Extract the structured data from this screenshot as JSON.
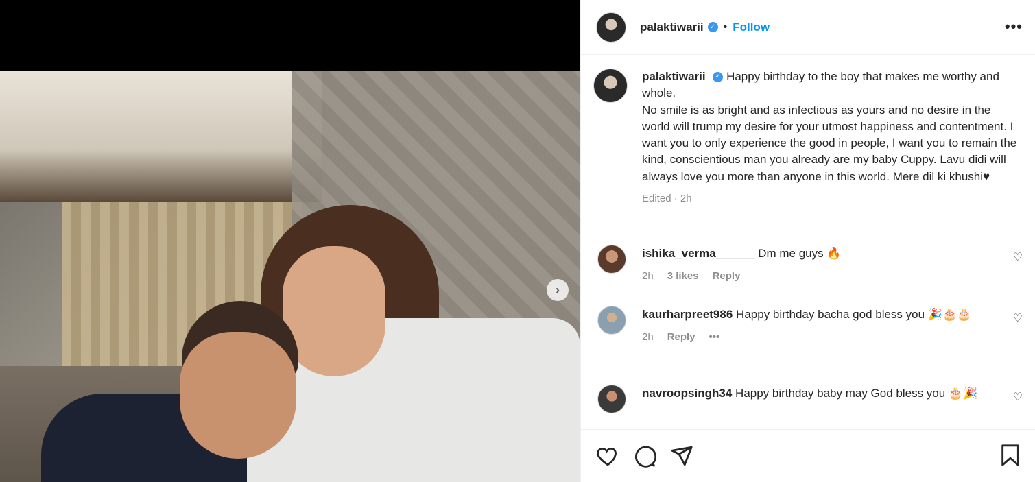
{
  "post": {
    "username": "palaktiwarii",
    "follow_label": "Follow",
    "dot": "•",
    "more": "•••"
  },
  "caption": {
    "username": "palaktiwarii",
    "text_line1": "Happy birthday to the boy that makes me worthy and whole.",
    "text_line2": "No smile is as bright and as infectious as yours and no desire in the world will trump my desire for your utmost happiness and contentment. I want you to only experience the good in people, I want you to remain the kind, conscientious man you already are my baby Cuppy. Lavu didi will always love you more than anyone in this world. Mere dil ki khushi♥",
    "meta": "Edited · 2h"
  },
  "comments": [
    {
      "username": "ishika_verma______",
      "text": "Dm me guys 🔥",
      "time": "2h",
      "likes": "3 likes",
      "reply": "Reply"
    },
    {
      "username": "kaurharpreet986",
      "text": "Happy birthday bacha god bless you 🎉🎂🎂",
      "time": "2h",
      "reply": "Reply",
      "more": "•••"
    },
    {
      "username": "navroopsingh34",
      "text": "Happy birthday baby may God bless you 🎂🎉",
      "time": "",
      "reply": ""
    }
  ],
  "icons": {
    "verified": "verified-badge-icon",
    "next": "chevron-right-icon",
    "like": "heart-icon",
    "comment": "comment-icon",
    "share": "send-icon",
    "save": "bookmark-icon"
  },
  "colors": {
    "accent": "#0095f6",
    "verified": "#3897f0",
    "muted": "#8e8e8e"
  }
}
